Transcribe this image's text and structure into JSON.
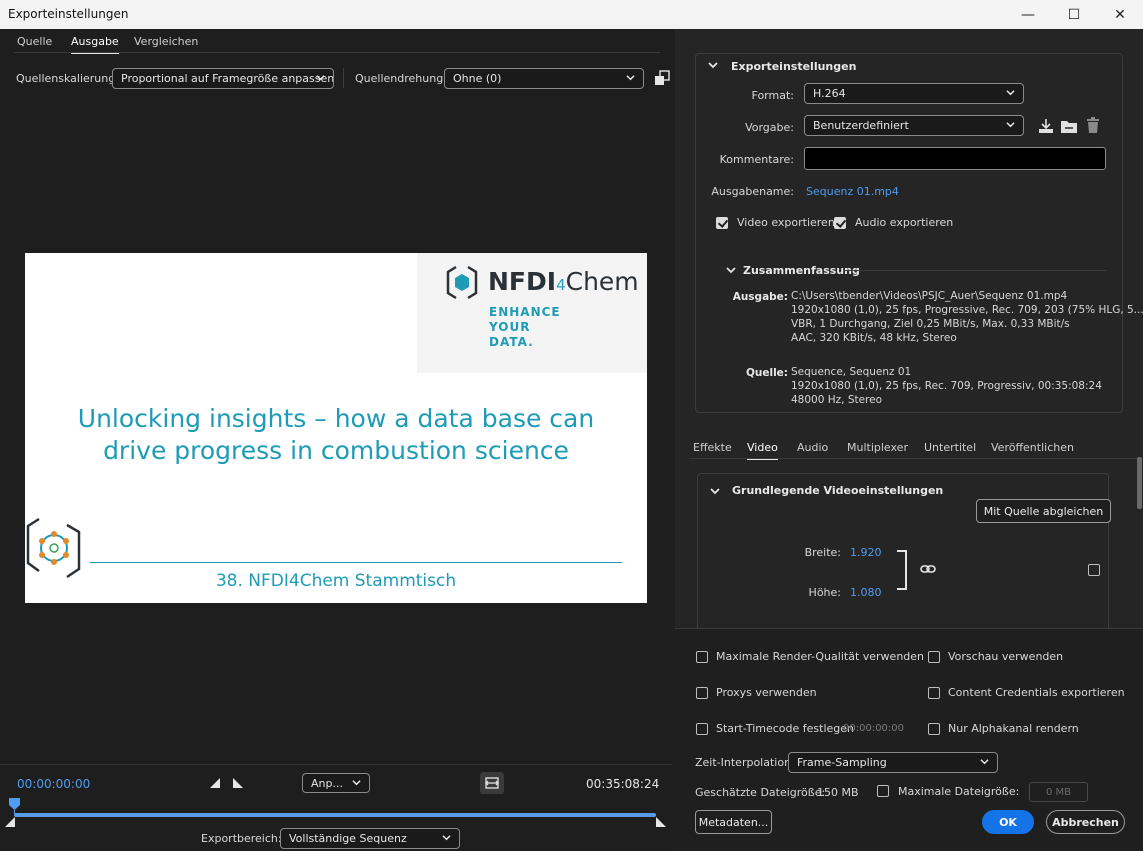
{
  "window": {
    "title": "Exporteinstellungen",
    "minimize": "—",
    "maximize": "☐",
    "close": "✕"
  },
  "left": {
    "tabs": [
      "Quelle",
      "Ausgabe",
      "Vergleichen"
    ],
    "active_tab": "Ausgabe",
    "source_scaling_label": "Quellenskalierung:",
    "source_scaling_value": "Proportional auf Framegröße anpassen",
    "source_rotation_label": "Quellendrehung:",
    "source_rotation_value": "Ohne (0)"
  },
  "preview": {
    "brand_nfdi": "NFDI",
    "brand_four": "4",
    "brand_chem": "Chem",
    "tagline": [
      "ENHANCE",
      "YOUR",
      "DATA."
    ],
    "title_line1": "Unlocking insights – how a data base can",
    "title_line2": "drive progress in combustion science",
    "subtitle": "38. NFDI4Chem Stammtisch"
  },
  "timeline": {
    "start_tc": "00:00:00:00",
    "end_tc": "00:35:08:24",
    "fit_dropdown": "Anp...",
    "export_range_label": "Exportbereich:",
    "export_range_value": "Vollständige Sequenz"
  },
  "export_settings": {
    "section_title": "Exporteinstellungen",
    "format_label": "Format:",
    "format_value": "H.264",
    "preset_label": "Vorgabe:",
    "preset_value": "Benutzerdefiniert",
    "comments_label": "Kommentare:",
    "comments_value": "",
    "output_name_label": "Ausgabename:",
    "output_name_value": "Sequenz 01.mp4",
    "export_video_label": "Video exportieren",
    "export_video_checked": true,
    "export_audio_label": "Audio exportieren",
    "export_audio_checked": true
  },
  "summary": {
    "title": "Zusammenfassung",
    "output_label": "Ausgabe:",
    "output_lines": [
      "C:\\Users\\tbender\\Videos\\PSJC_Auer\\Sequenz 01.mp4",
      "1920x1080 (1,0), 25 fps, Progressive, Rec. 709, 203 (75% HLG, 5...",
      "VBR, 1 Durchgang, Ziel 0,25 MBit/s, Max. 0,33 MBit/s",
      "AAC, 320 KBit/s, 48 kHz, Stereo"
    ],
    "source_label": "Quelle:",
    "source_lines": [
      "Sequence, Sequenz 01",
      "1920x1080 (1,0), 25 fps, Rec. 709, Progressiv, 00:35:08:24",
      "48000 Hz, Stereo"
    ]
  },
  "right_tabs": [
    "Effekte",
    "Video",
    "Audio",
    "Multiplexer",
    "Untertitel",
    "Veröffentlichen"
  ],
  "right_active_tab": "Video",
  "video": {
    "section_title": "Grundlegende Videoeinstellungen",
    "match_source_button": "Mit Quelle abgleichen",
    "width_label": "Breite:",
    "width_value": "1.920",
    "height_label": "Höhe:",
    "height_value": "1.080"
  },
  "options": {
    "max_render_quality": "Maximale Render-Qualität verwenden",
    "use_preview": "Vorschau verwenden",
    "use_proxies": "Proxys verwenden",
    "export_content_credentials": "Content Credentials exportieren",
    "set_start_timecode": "Start-Timecode festlegen",
    "start_timecode_value": "00:00:00:00",
    "render_alpha_only": "Nur Alphakanal rendern",
    "time_interpolation_label": "Zeit-Interpolation:",
    "time_interpolation_value": "Frame-Sampling",
    "estimated_size_label": "Geschätzte Dateigröße:",
    "estimated_size_value": "150 MB",
    "max_file_size_label": "Maximale Dateigröße:",
    "max_file_size_value": "0 MB",
    "metadata_button": "Metadaten...",
    "ok_button": "OK",
    "cancel_button": "Abbrechen"
  },
  "colors": {
    "accent": "#4f9cf0",
    "ok": "#1473e6",
    "brand_teal": "#1e9bb6"
  }
}
